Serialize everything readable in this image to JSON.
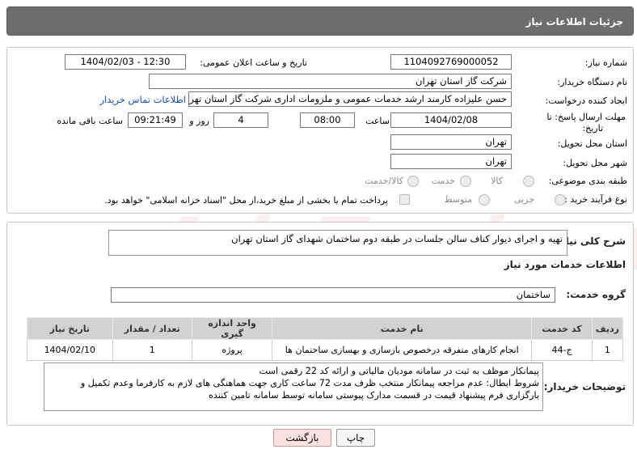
{
  "header": {
    "title": "جزئیات اطلاعات نیاز"
  },
  "need": {
    "number_label": "شماره نیاز:",
    "number": "1104092769000052",
    "announce_label": "تاریخ و ساعت اعلان عمومی:",
    "announce_value": "1404/02/03 - 12:30",
    "buyer_label": "نام دستگاه خریدار:",
    "buyer": "شرکت گاز استان تهران",
    "creator_label": "ایجاد کننده درخواست:",
    "creator": "حسن علیزاده کارمند ارشد خدمات عمومی و ملزومات اداری شرکت گاز استان تهران",
    "contact_link": "اطلاعات تماس خریدار",
    "deadline_label_1": "مهلت ارسال پاسخ: تا",
    "deadline_label_2": "تاریخ:",
    "deadline_date": "1404/02/08",
    "time_label": "ساعت",
    "deadline_time": "08:00",
    "days": "4",
    "days_label": "روز و",
    "remaining": "09:21:49",
    "remaining_label": "ساعت باقی مانده",
    "province_label": "استان محل تحویل:",
    "province": "تهران",
    "city_label": "شهر محل تحویل:",
    "city": "تهران",
    "category_label": "طبقه بندی موضوعی:",
    "category_options": [
      "کالا",
      "خدمت",
      "کالا/خدمت"
    ],
    "process_label": "نوع فرآیند خرید :",
    "process_options": [
      "جزیی",
      "متوسط"
    ],
    "payment_text": "پرداخت تمام یا بخشی از مبلغ خرید،از محل \"اسناد خزانه اسلامی\" خواهد بود."
  },
  "summary": {
    "label": "شرح کلی نیاز:",
    "text": "تهیه و اجرای دیوار کناف سالن جلسات در طبقه دوم ساختمان شهدای گاز استان تهران"
  },
  "services": {
    "title": "اطلاعات خدمات مورد نیاز",
    "group_label": "گروه خدمت:",
    "group": "ساختمان",
    "columns": [
      "ردیف",
      "کد خدمت",
      "نام خدمت",
      "واحد اندازه گیری",
      "تعداد / مقدار",
      "تاریخ نیاز"
    ],
    "rows": [
      [
        "1",
        "ج-44",
        "انجام کارهای متفرقه درخصوص بازسازی و بهسازی ساختمان ها",
        "پروژه",
        "1",
        "1404/02/10"
      ]
    ]
  },
  "notes": {
    "label": "توضیحات خریدار:",
    "lines": [
      "پیمانکار موظف به ثبت در سامانه مودیان مالیاتی و ارائه کد 22 رقمی است",
      "شروط ابطال: عدم مراجعه پیمانکار منتخب ظرف مدت 72 ساعت کاری جهت هماهنگی های لازم به کارفرما وعدم تکمیل و",
      "بارگزاری فرم پیشنهاد قیمت در قسمت مدارک پیوستی سامانه توسط سامانه تامین کننده"
    ]
  },
  "buttons": {
    "print": "چاپ",
    "back": "بازگشت"
  },
  "watermark": "AriaTender.neT",
  "colors": {
    "header_bg": "#6d6d6d",
    "link": "#1a4da8",
    "back_btn_bg": "#fbe1e1"
  }
}
